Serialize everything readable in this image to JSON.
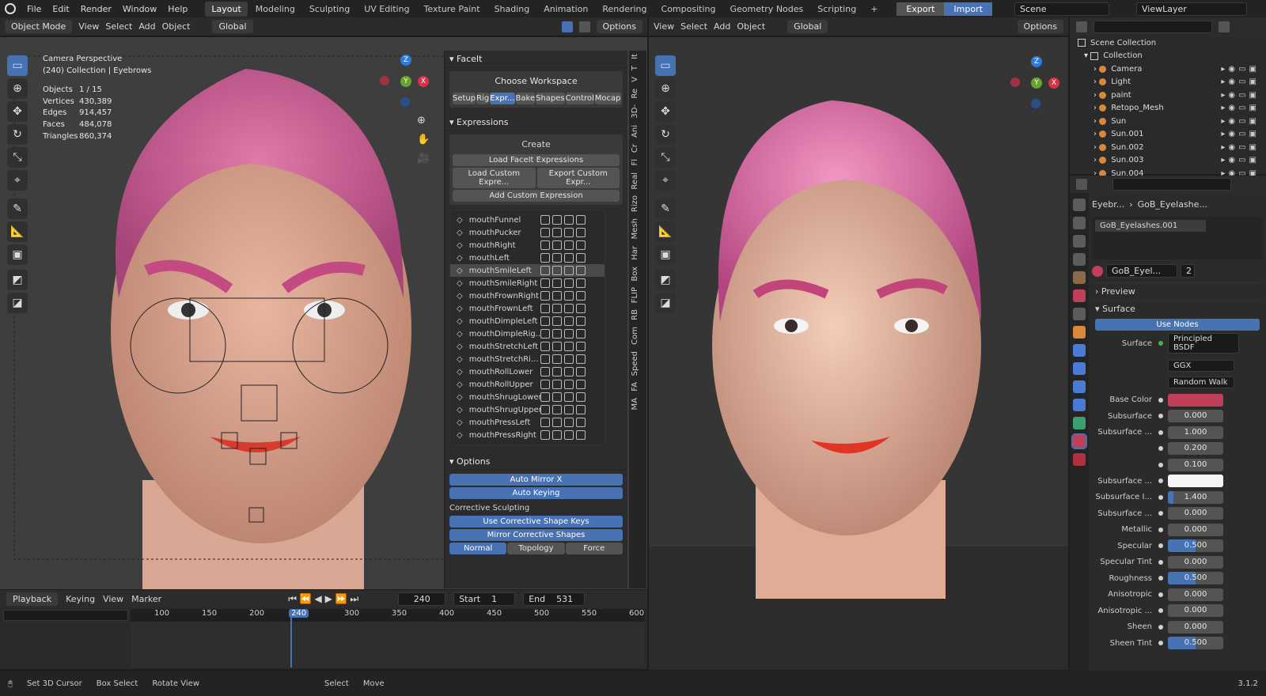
{
  "menu": [
    "File",
    "Edit",
    "Render",
    "Window",
    "Help"
  ],
  "workspaces": [
    "Layout",
    "Modeling",
    "Sculpting",
    "UV Editing",
    "Texture Paint",
    "Shading",
    "Animation",
    "Rendering",
    "Compositing",
    "Geometry Nodes",
    "Scripting"
  ],
  "add_ws": "+",
  "export_label": "Export",
  "import_label": "Import",
  "scene": "Scene",
  "viewlayer": "ViewLayer",
  "left_header": {
    "mode": "Object Mode",
    "view": "View",
    "select": "Select",
    "add": "Add",
    "object": "Object",
    "orientation": "Global",
    "options": "Options"
  },
  "right_header": {
    "view": "View",
    "select": "Select",
    "add": "Add",
    "object": "Object",
    "orientation": "Global",
    "options": "Options"
  },
  "overlay": {
    "camera": "Camera Perspective",
    "collection": "(240) Collection | Eyebrows",
    "stats": [
      {
        "k": "Objects",
        "v": "1 / 15"
      },
      {
        "k": "Vertices",
        "v": "430,389"
      },
      {
        "k": "Edges",
        "v": "914,457"
      },
      {
        "k": "Faces",
        "v": "484,078"
      },
      {
        "k": "Triangles",
        "v": "860,374"
      }
    ]
  },
  "gizmo": {
    "x": "X",
    "y": "Y",
    "z": "Z"
  },
  "faceit": {
    "title": "FaceIt",
    "choose_workspace": "Choose Workspace",
    "ws_tabs": [
      "Setup",
      "Rig",
      "Expr...",
      "Bake",
      "Shapes",
      "Control",
      "Mocap"
    ],
    "expressions_title": "Expressions",
    "create": "Create",
    "load_faceit": "Load FaceIt Expressions",
    "load_custom": "Load Custom Expre...",
    "export_custom": "Export Custom Expr...",
    "add_custom": "Add Custom Expression",
    "items": [
      "mouthFunnel",
      "mouthPucker",
      "mouthRight",
      "mouthLeft",
      "mouthSmileLeft",
      "mouthSmileRight",
      "mouthFrownRight",
      "mouthFrownLeft",
      "mouthDimpleLeft",
      "mouthDimpleRig...",
      "mouthStretchLeft",
      "mouthStretchRi...",
      "mouthRollLower",
      "mouthRollUpper",
      "mouthShrugLower",
      "mouthShrugUpper",
      "mouthPressLeft",
      "mouthPressRight"
    ],
    "selected_item": "mouthSmileLeft",
    "options_title": "Options",
    "auto_mirror": "Auto Mirror X",
    "auto_keying": "Auto Keying",
    "corrective": "Corrective Sculpting",
    "use_corrective": "Use Corrective Shape Keys",
    "mirror_corrective": "Mirror Corrective Shapes",
    "modes": [
      "Normal",
      "Topology",
      "Force"
    ]
  },
  "vtabs": [
    "It",
    "T",
    "V",
    "Re",
    "3D-",
    "Ani",
    "Cr",
    "Fl",
    "Real",
    "Rizo",
    "Mesh",
    "Har",
    "Box",
    "FLIP",
    "RB",
    "Com",
    "Speed",
    "FA",
    "MA"
  ],
  "timeline": {
    "playback": "Playback",
    "keying": "Keying",
    "view": "View",
    "marker": "Marker",
    "current": "240",
    "start_label": "Start",
    "start": "1",
    "end_label": "End",
    "end": "531",
    "ticks": [
      "100",
      "150",
      "200",
      "240",
      "300",
      "350",
      "400",
      "450",
      "500",
      "550",
      "600"
    ]
  },
  "outliner": {
    "title": "Scene Collection",
    "collection": "Collection",
    "items": [
      "Camera",
      "Light",
      "paint",
      "Retopo_Mesh",
      "Sun",
      "Sun.001",
      "Sun.002",
      "Sun.003",
      "Sun.004"
    ]
  },
  "properties": {
    "breadcrumb1": "Eyebr...",
    "breadcrumb2": "GoB_Eyelashe...",
    "slot": "GoB_Eyelashes.001",
    "material": "GoB_Eyel...",
    "users": "2",
    "preview": "Preview",
    "surface_section": "Surface",
    "use_nodes": "Use Nodes",
    "surface_label": "Surface",
    "surface_value": "Principled BSDF",
    "dist": "GGX",
    "sss_method": "Random Walk",
    "rows": [
      {
        "label": "Base Color",
        "type": "color",
        "color": "#c0405a"
      },
      {
        "label": "Subsurface",
        "type": "num",
        "value": "0.000",
        "fill": 0
      },
      {
        "label": "Subsurface ...",
        "type": "num",
        "value": "1.000",
        "fill": 0
      },
      {
        "label": "",
        "type": "num",
        "value": "0.200",
        "fill": 0
      },
      {
        "label": "",
        "type": "num",
        "value": "0.100",
        "fill": 0
      },
      {
        "label": "Subsurface ...",
        "type": "color",
        "color": "#f5f5f5"
      },
      {
        "label": "Subsurface I...",
        "type": "num",
        "value": "1.400",
        "fill": 0.1
      },
      {
        "label": "Subsurface ...",
        "type": "num",
        "value": "0.000",
        "fill": 0
      },
      {
        "label": "Metallic",
        "type": "num",
        "value": "0.000",
        "fill": 0
      },
      {
        "label": "Specular",
        "type": "num",
        "value": "0.500",
        "fill": 0.5
      },
      {
        "label": "Specular Tint",
        "type": "num",
        "value": "0.000",
        "fill": 0
      },
      {
        "label": "Roughness",
        "type": "num",
        "value": "0.500",
        "fill": 0.5
      },
      {
        "label": "Anisotropic",
        "type": "num",
        "value": "0.000",
        "fill": 0
      },
      {
        "label": "Anisotropic ...",
        "type": "num",
        "value": "0.000",
        "fill": 0
      },
      {
        "label": "Sheen",
        "type": "num",
        "value": "0.000",
        "fill": 0
      },
      {
        "label": "Sheen Tint",
        "type": "num",
        "value": "0.500",
        "fill": 0.5
      }
    ]
  },
  "status": {
    "cursor": "Set 3D Cursor",
    "box": "Box Select",
    "rotate": "Rotate View",
    "select": "Select",
    "move": "Move",
    "version": "3.1.2"
  }
}
